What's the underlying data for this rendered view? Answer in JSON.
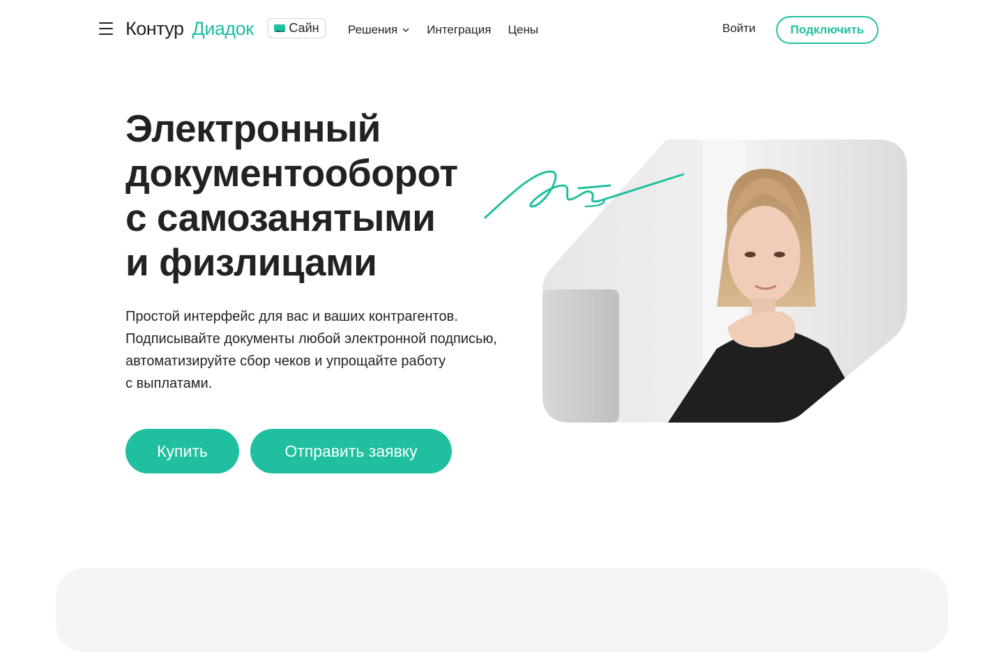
{
  "header": {
    "logo_primary": "Контур",
    "logo_secondary": "Диадок",
    "sign_badge": "Сайн",
    "nav": [
      {
        "label": "Решения",
        "has_dropdown": true
      },
      {
        "label": "Интеграция",
        "has_dropdown": false
      },
      {
        "label": "Цены",
        "has_dropdown": false
      }
    ],
    "login_label": "Войти",
    "connect_label": "Подключить"
  },
  "hero": {
    "title_lines": [
      "Электронный",
      "документооборот",
      "с самозанятыми",
      "и физлицами"
    ],
    "text_lines": [
      "Простой интерфейс для вас и ваших контрагентов.",
      "Подписывайте документы любой электронной подписью,",
      "автоматизируйте сбор чеков и упрощайте работу",
      "с выплатами."
    ],
    "buy_label": "Купить",
    "request_label": "Отправить заявку"
  },
  "colors": {
    "accent": "#1fbf9f",
    "text": "#222222",
    "card_bg": "#f5f5f5"
  },
  "icons": {
    "menu": "hamburger-icon",
    "dropdown": "chevron-down-icon",
    "signature": "signature-icon"
  }
}
